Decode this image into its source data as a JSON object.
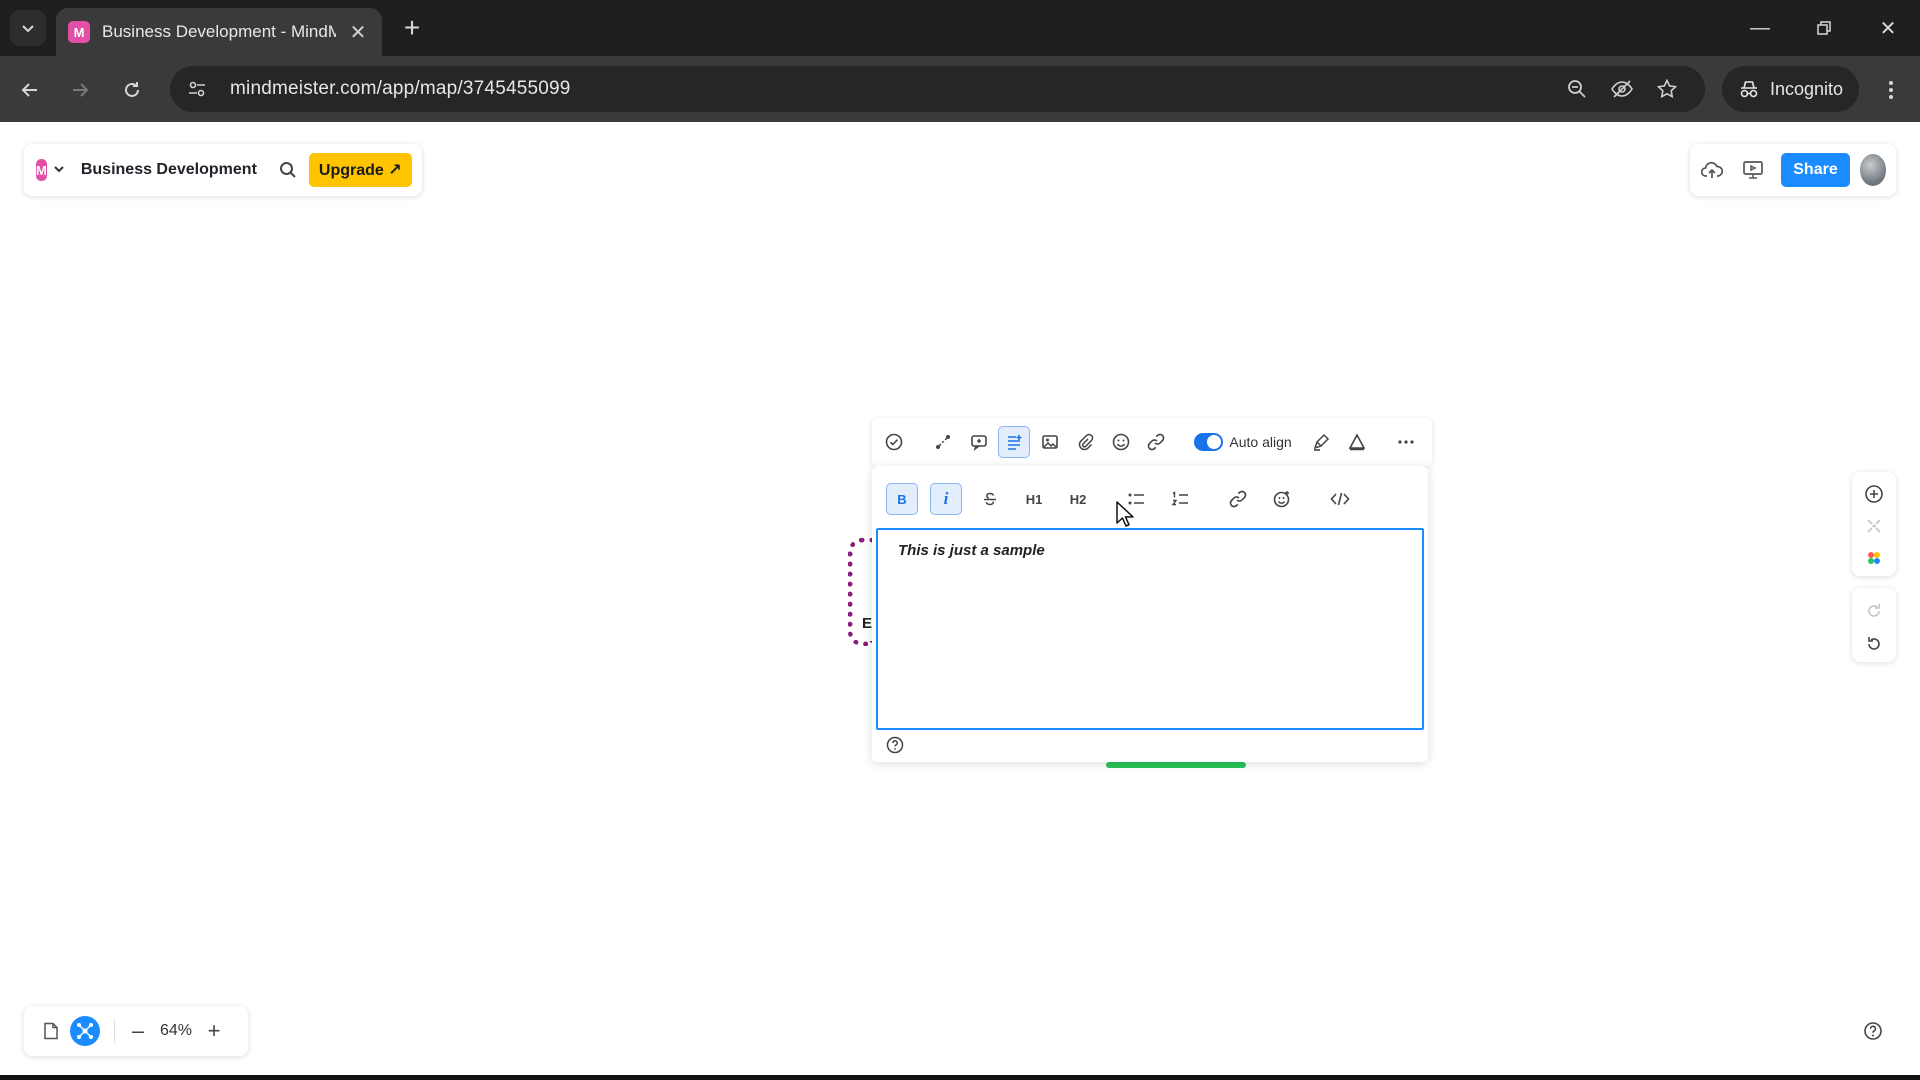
{
  "browser": {
    "tab_title": "Business Development - MindMeister",
    "favicon_letter": "M",
    "url": "mindmeister.com/app/map/3745455099",
    "incognito_label": "Incognito"
  },
  "app": {
    "brand_letter": "M",
    "map_title": "Business Development",
    "upgrade_label": "Upgrade ↗",
    "share_label": "Share",
    "accent_color": "#1a8cff",
    "upgrade_color": "#ffc400"
  },
  "node_toolbar": {
    "auto_align_label": "Auto align",
    "auto_align_on": true,
    "icons": [
      "task-icon",
      "connect-icon",
      "comment-icon",
      "note-icon",
      "image-icon",
      "attachment-icon",
      "emoji-icon",
      "link-icon",
      "auto-align-toggle",
      "style-icon",
      "color-icon",
      "more-icon"
    ]
  },
  "note_editor": {
    "bold_label": "B",
    "italic_label": "i",
    "h1_label": "H1",
    "h2_label": "H2",
    "text": "This is just a sample"
  },
  "node": {
    "partial_letter": "E",
    "border_color": "#8a1c7c"
  },
  "zoom": {
    "value": "64%",
    "minus": "–",
    "plus": "+"
  }
}
